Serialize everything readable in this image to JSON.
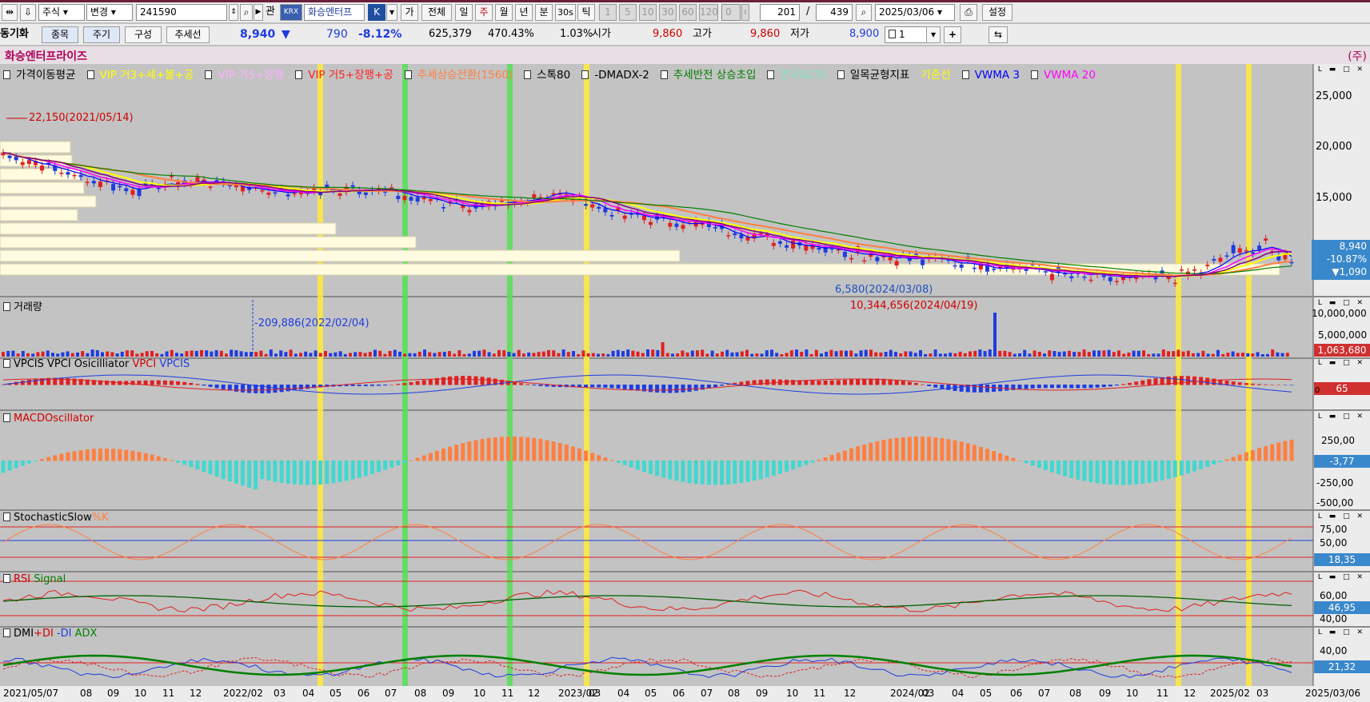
{
  "toolbar1": {
    "market": "주식",
    "mode": "변경",
    "code": "241590",
    "btn_gwan": "관",
    "krx": "KRX",
    "name_field": "화승엔터프",
    "k_btn": "K",
    "ga": "가",
    "all": "전체",
    "periods": [
      "일",
      "주",
      "월",
      "년",
      "분",
      "30s",
      "틱"
    ],
    "numbers": [
      "1",
      "5",
      "10",
      "30",
      "60",
      "120"
    ],
    "zero": "0",
    "count": "201",
    "slash": "/",
    "total": "439",
    "date": "2025/03/06",
    "settings": "설정"
  },
  "toolbar2": {
    "sync": "동기화",
    "tabs": [
      "종목",
      "주기",
      "구성",
      "추세선"
    ],
    "price": "8,940",
    "arrow": "▼",
    "change": "790",
    "change_pct": "-8.12%",
    "volume": "625,379",
    "vol_ratio": "470.43%",
    "turnover": "1.03%",
    "open_label": "시가",
    "open": "9,860",
    "high_label": "고가",
    "high": "9,860",
    "low_label": "저가",
    "low": "8,900",
    "qty": "1"
  },
  "title": {
    "name": "화승엔터프라이즈",
    "right": "(주)"
  },
  "legend": [
    {
      "text": "가격이동평균",
      "color": "#000000"
    },
    {
      "text": "VIP 거3+세+볼+공",
      "color": "#ffff00"
    },
    {
      "text": "VIP 거5+장팽",
      "color": "#ffb0ff"
    },
    {
      "text": "VIP 거5+장팽+공",
      "color": "#ff2020"
    },
    {
      "text": "추세상승전환(1560)",
      "color": "#ff7f40"
    },
    {
      "text": "스톡80",
      "color": "#000000"
    },
    {
      "text": "-DMADX-2",
      "color": "#000000"
    },
    {
      "text": "추세반전 상승초입",
      "color": "#008000"
    },
    {
      "text": "변곡&CI5",
      "color": "#80e0c0"
    },
    {
      "text": "일목균형지표",
      "color": "#000000"
    },
    {
      "text": "기준선",
      "color": "#ffff00"
    },
    {
      "text": "VWMA 3",
      "color": "#0000ff"
    },
    {
      "text": "VWMA 20",
      "color": "#ff00ff"
    }
  ],
  "price_panel": {
    "axis": [
      "25,000",
      "20,000",
      "15,000"
    ],
    "high_note": "22,150(2021/05/14)",
    "low_note": "6,580(2024/03/08)",
    "last": "8,940",
    "last_pct": "-10.87%",
    "last_chg": "▼1,090"
  },
  "volume_panel": {
    "title": "거래량",
    "axis": [
      "10,000,000",
      "5,000,000"
    ],
    "last": "1,063,680",
    "low_note": "-209,886(2022/02/04)",
    "high_note": "10,344,656(2024/04/19)"
  },
  "vpci_panel": {
    "t1": "VPCIS VPCI Osicilliator",
    "t2": "VPCI",
    "t3": "VPCIS",
    "last": "65",
    "zero": "0"
  },
  "macd_panel": {
    "title": "MACDOscillator",
    "axis": [
      "250,00",
      "0",
      "-250,00",
      "-500,00"
    ],
    "last": "-3,77"
  },
  "stoch_panel": {
    "title": "StochasticSlow",
    "k": "%K",
    "axis": [
      "75,00",
      "50,00"
    ],
    "last": "18,35"
  },
  "rsi_panel": {
    "t1": "RSI",
    "t2": "Signal",
    "axis": [
      "60,00",
      "40,00"
    ],
    "last": "46,95"
  },
  "dmi_panel": {
    "t1": "DMI",
    "t2": "+DI",
    "t3": "-DI",
    "t4": "ADX",
    "axis": [
      "40,00"
    ],
    "last": "21,32"
  },
  "xaxis": [
    "2021/05/07",
    "08",
    "09",
    "10",
    "11",
    "12",
    "2022/02",
    "03",
    "04",
    "05",
    "06",
    "07",
    "08",
    "09",
    "10",
    "11",
    "12",
    "2023/02",
    "03",
    "04",
    "05",
    "06",
    "07",
    "08",
    "09",
    "10",
    "11",
    "12",
    "2024/02",
    "03",
    "04",
    "05",
    "06",
    "07",
    "08",
    "09",
    "10",
    "11",
    "12",
    "2025/02",
    "03",
    "2025/03/06"
  ]
}
